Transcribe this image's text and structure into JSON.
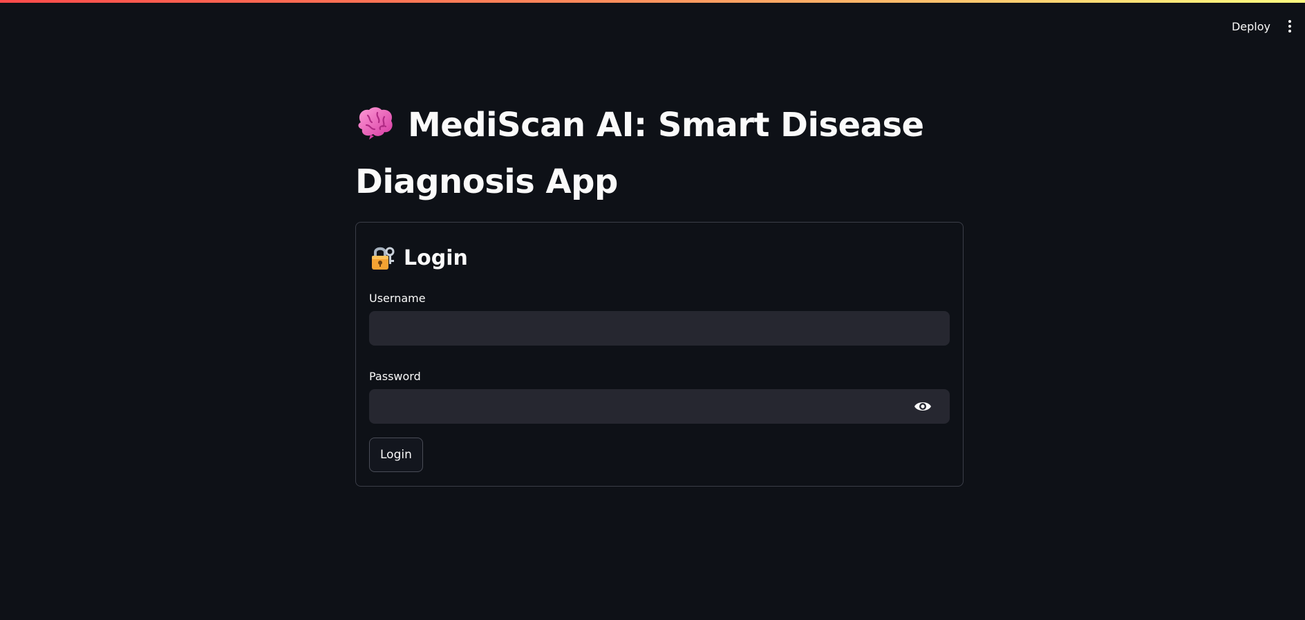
{
  "header": {
    "deploy_label": "Deploy",
    "menu_icon": "vertical-ellipsis-icon"
  },
  "main": {
    "title": "MediScan AI: Smart Disease Diagnosis App",
    "title_icon": "brain-icon"
  },
  "login": {
    "heading": "Login",
    "heading_icon": "lock-with-key-icon",
    "username_label": "Username",
    "username_value": "",
    "password_label": "Password",
    "password_value": "",
    "show_password_icon": "eye-icon",
    "submit_label": "Login"
  },
  "colors": {
    "background": "#0e1117",
    "input_background": "#262730",
    "border": "#3b3e48",
    "text": "#fafafa",
    "accent_gradient_start": "#ff4b4b",
    "accent_gradient_end": "#fffd80"
  }
}
